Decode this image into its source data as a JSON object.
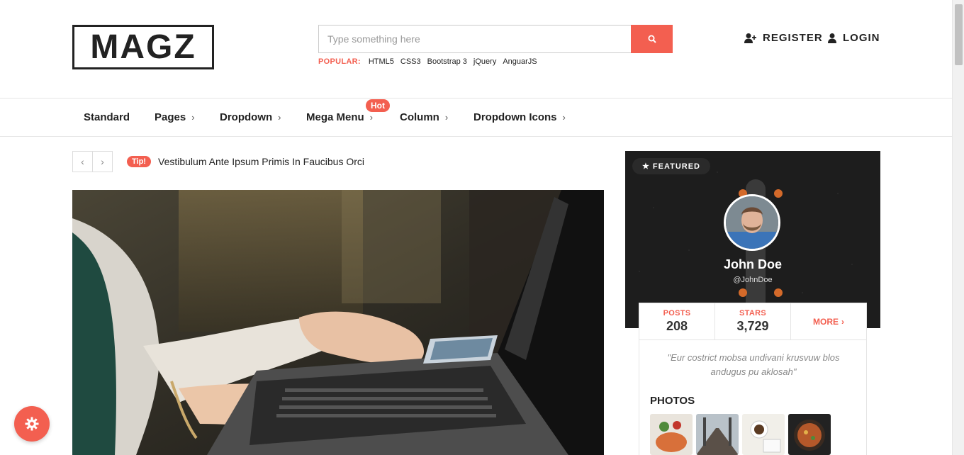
{
  "header": {
    "logo": "MAGZ",
    "search_placeholder": "Type something here",
    "popular_label": "POPULAR:",
    "popular_tags": [
      "HTML5",
      "CSS3",
      "Bootstrap 3",
      "jQuery",
      "AnguarJS"
    ],
    "register_label": "REGISTER",
    "login_label": "LOGIN"
  },
  "nav": {
    "items": [
      {
        "label": "Standard"
      },
      {
        "label": "Pages"
      },
      {
        "label": "Dropdown"
      },
      {
        "label": "Mega Menu"
      },
      {
        "label": "Column"
      },
      {
        "label": "Dropdown Icons"
      }
    ],
    "hot_badge": "Hot"
  },
  "ticker": {
    "tip_label": "Tip!",
    "text": "Vestibulum Ante Ipsum Primis In Faucibus Orci"
  },
  "featured": {
    "badge": "★ FEATURED",
    "name": "John Doe",
    "handle": "@JohnDoe",
    "stats": [
      {
        "label": "POSTS",
        "value": "208"
      },
      {
        "label": "STARS",
        "value": "3,729"
      }
    ],
    "more_label": "MORE",
    "quote": "\"Eur costrict mobsa undivani krusvuw blos andugus pu aklosah\"",
    "photos_title": "PHOTOS"
  },
  "colors": {
    "accent": "#f35f50",
    "text_dark": "#222222",
    "card_dark": "#1e1e1e"
  },
  "icons": [
    "search-icon",
    "user-plus-icon",
    "user-icon",
    "chevron-left-icon",
    "chevron-right-icon",
    "gear-icon",
    "star-icon"
  ]
}
